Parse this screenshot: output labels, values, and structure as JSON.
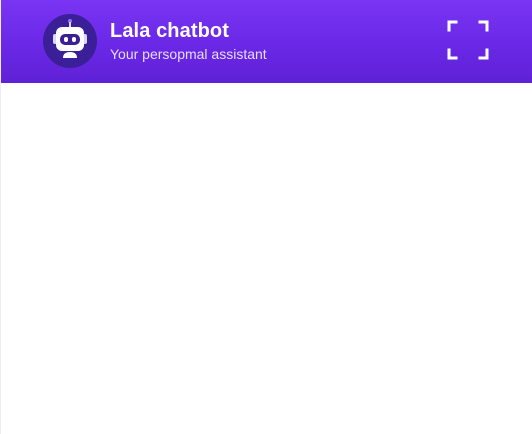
{
  "header": {
    "title": "Lala chatbot",
    "subtitle": "Your persopmal assistant",
    "avatar_icon": "robot-icon",
    "expand_icon": "fullscreen-icon"
  },
  "colors": {
    "header_gradient_top": "#7a34f4",
    "header_gradient_bottom": "#5f21d6",
    "avatar_background": "#3b1f98",
    "body_background": "#ffffff"
  }
}
